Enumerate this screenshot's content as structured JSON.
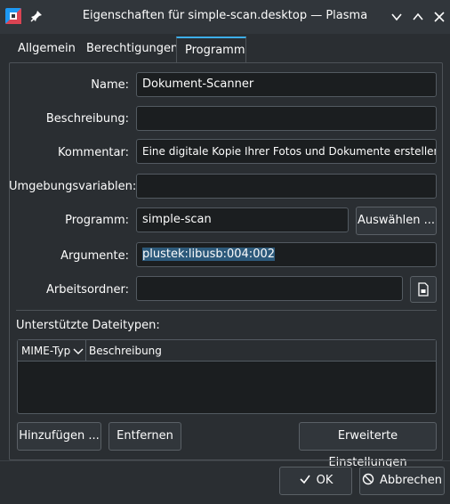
{
  "window": {
    "title": "Eigenschaften für simple-scan.desktop — Plasma",
    "controls": [
      "chevron-down-icon",
      "chevron-up-icon",
      "close-icon"
    ]
  },
  "tabs": [
    {
      "label": "Allgemein",
      "active": false
    },
    {
      "label": "Berechtigungen",
      "active": false
    },
    {
      "label": "Programm",
      "active": true
    }
  ],
  "form": {
    "name_label": "Name:",
    "name_value": "Dokument-Scanner",
    "beschreibung_label": "Beschreibung:",
    "beschreibung_value": "",
    "kommentar_label": "Kommentar:",
    "kommentar_value": "Eine digitale Kopie Ihrer Fotos und Dokumente erstellen",
    "umgebung_label": "Umgebungsvariablen:",
    "umgebung_value": "",
    "programm_label": "Programm:",
    "programm_value": "simple-scan",
    "auswaehlen_label": "Auswählen ...",
    "argumente_label": "Argumente:",
    "argumente_value": "plustek:libusb:004:002",
    "arbeitsordner_label": "Arbeitsordner:",
    "arbeitsordner_value": ""
  },
  "filetypes": {
    "heading": "Unterstützte Dateitypen:",
    "col_mime": "MIME-Typ",
    "col_desc": "Beschreibung",
    "rows": []
  },
  "actions": {
    "add": "Hinzufügen ...",
    "remove": "Entfernen",
    "advanced": "Erweiterte Einstellungen"
  },
  "dialog": {
    "ok": "OK",
    "cancel": "Abbrechen"
  },
  "colors": {
    "accent": "#3daee9",
    "background": "#2a2e32",
    "field": "#1b1e20"
  }
}
